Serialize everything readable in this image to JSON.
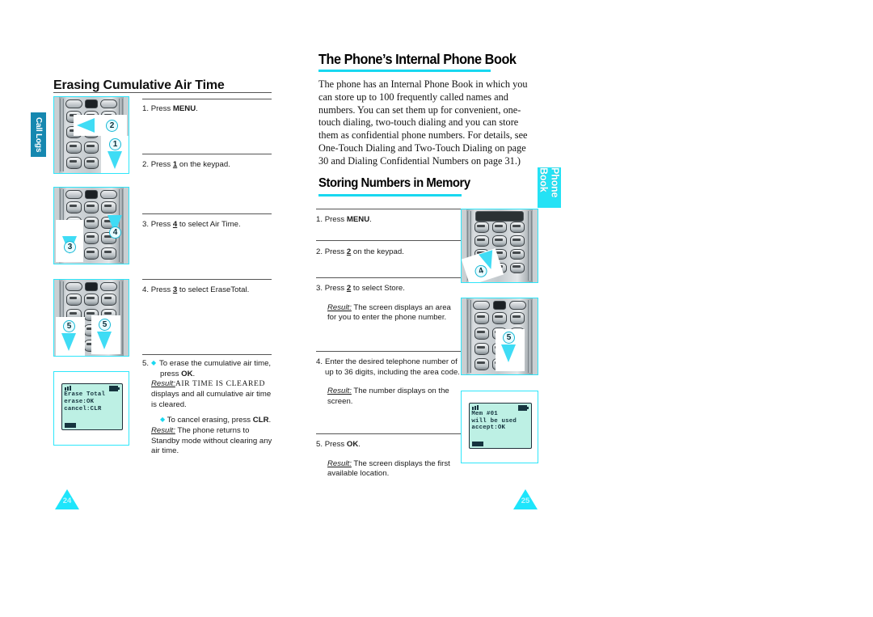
{
  "document": {
    "type": "cell-phone-user-manual-spread"
  },
  "left_page": {
    "tab_label": "Call Logs",
    "page_number": "24",
    "heading": "Erasing Cumulative Air Time",
    "steps": [
      {
        "number": "1.",
        "text_before": "Press ",
        "bold": "MENU",
        "text_after": "."
      },
      {
        "number": "2.",
        "text_before": "Press ",
        "bold": "1",
        "text_after": " on the keypad."
      },
      {
        "number": "3.",
        "text_before": "Press ",
        "bold": "4",
        "text_after": " to select Air Time."
      },
      {
        "number": "4.",
        "text_before": "Press ",
        "bold": "3",
        "text_after": " to select EraseTotal."
      }
    ],
    "step5": {
      "number": "5.",
      "line1": "To erase the cumulative air time,",
      "line2_before": "press ",
      "line2_bold": "OK",
      "line2_after": ".",
      "result_label": "Result:",
      "result_mono": "AIR TIME IS CLEARED",
      "result_rest": " displays and all cumulative air time is cleared.",
      "cancel_before": "To cancel erasing, press ",
      "cancel_bold": "CLR",
      "cancel_after": ".",
      "cancel_result_label": "Result:",
      "cancel_result_text": " The phone returns to Standby mode without clearing any air time."
    },
    "lcd": {
      "line1": "Erase Total",
      "line2": "erase:OK",
      "line3": "cancel:CLR"
    },
    "callouts": [
      "2",
      "1",
      "3",
      "4",
      "5",
      "5"
    ]
  },
  "right_page": {
    "tab_label": "Phone Book",
    "page_number": "25",
    "heading_main": "The Phone’s Internal Phone Book",
    "intro_paragraph": "The phone has an Internal Phone Book in which you can store up to 100 frequently called names and numbers. You can set them up for convenient, one-touch dialing, two-touch dialing and you can store them as confidential phone numbers. For details, see One-Touch Dialing and Two-Touch Dialing on page 30 and Dialing Confidential Numbers on page 31.)",
    "heading_sub": "Storing Numbers in Memory",
    "steps": [
      {
        "number": "1.",
        "text_before": "Press ",
        "bold": "MENU",
        "text_after": "."
      },
      {
        "number": "2.",
        "text_before": "Press ",
        "bold": "2",
        "text_after": " on the keypad."
      },
      {
        "number": "3.",
        "text_before": "Press ",
        "bold": "2",
        "text_after": " to select Store.",
        "result_label": "Result:",
        "result_text": " The screen displays an area for you to enter the phone number."
      },
      {
        "number": "4.",
        "text_plain": "Enter the desired telephone number of up to 36 digits, including the area code.",
        "result_label": "Result:",
        "result_text": " The number displays on the screen."
      },
      {
        "number": "5.",
        "text_before": "Press ",
        "bold": "OK",
        "text_after": ".",
        "result_label": "Result:",
        "result_text": " The screen displays the first available location."
      }
    ],
    "lcd": {
      "line1": "Mem #01",
      "line2": "will be used",
      "line3": "accept:OK"
    },
    "callouts": [
      "4",
      "5"
    ]
  },
  "colors": {
    "accent_cyan": "#1ee5fb",
    "tab_blue": "#1688b0",
    "lcd_green": "#bdf0e4",
    "rule_dark": "#555555"
  }
}
